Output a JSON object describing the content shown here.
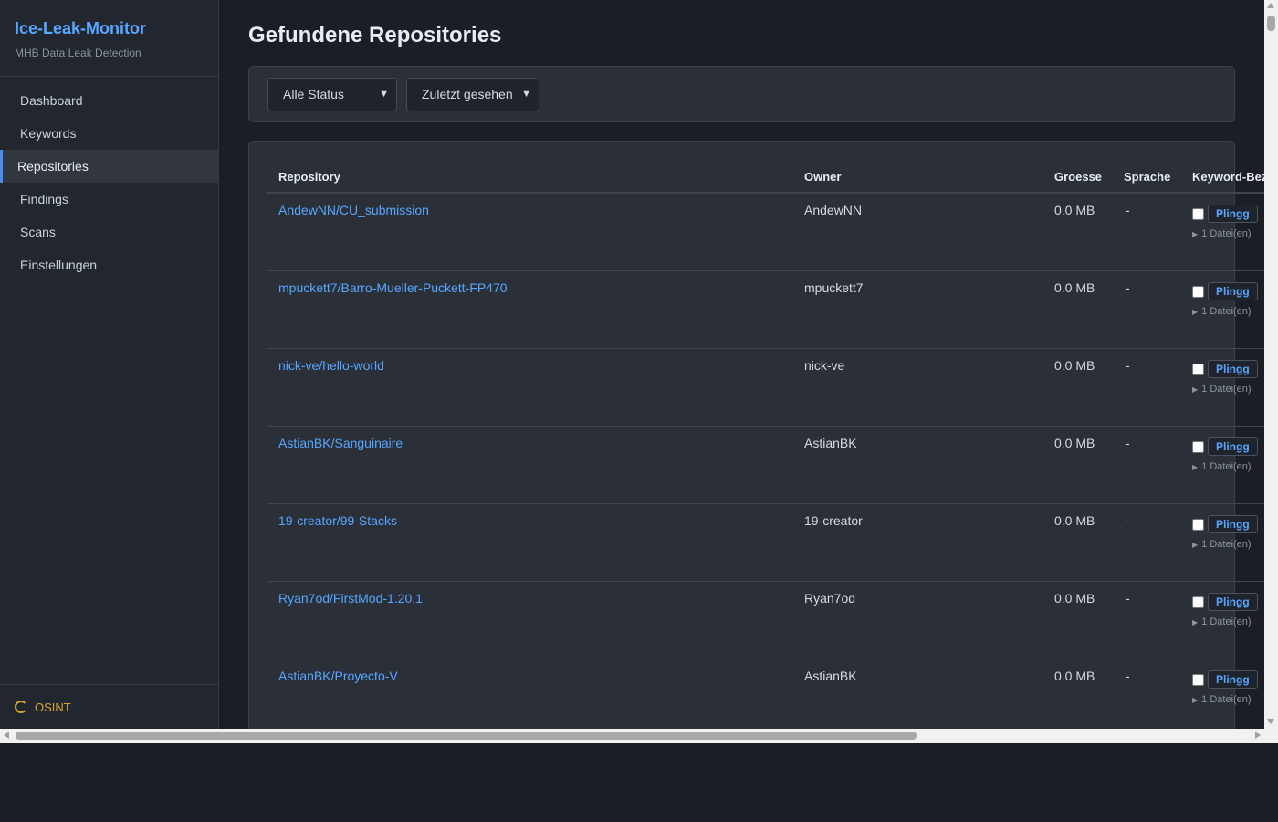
{
  "app": {
    "title": "Ice-Leak-Monitor",
    "subtitle": "MHB Data Leak Detection"
  },
  "sidebar": {
    "items": [
      {
        "label": "Dashboard",
        "active": false
      },
      {
        "label": "Keywords",
        "active": false
      },
      {
        "label": "Repositories",
        "active": true
      },
      {
        "label": "Findings",
        "active": false
      },
      {
        "label": "Scans",
        "active": false
      },
      {
        "label": "Einstellungen",
        "active": false
      }
    ],
    "footer": {
      "label": "OSINT",
      "icon": "spinner-icon",
      "color": "#d4a72c"
    }
  },
  "page": {
    "title": "Gefundene Repositories"
  },
  "filters": {
    "status": {
      "selected": "Alle Status"
    },
    "sort": {
      "selected": "Zuletzt gesehen"
    }
  },
  "table": {
    "columns": {
      "repository": "Repository",
      "owner": "Owner",
      "size": "Groesse",
      "language": "Sprache",
      "keyword": "Keyword-Bez"
    },
    "rows": [
      {
        "repo": "AndewNN/CU_submission",
        "owner": "AndewNN",
        "size": "0.0 MB",
        "lang": "-",
        "keyword": "Plingg",
        "files": "1 Datei(en)"
      },
      {
        "repo": "mpuckett7/Barro-Mueller-Puckett-FP470",
        "owner": "mpuckett7",
        "size": "0.0 MB",
        "lang": "-",
        "keyword": "Plingg",
        "files": "1 Datei(en)"
      },
      {
        "repo": "nick-ve/hello-world",
        "owner": "nick-ve",
        "size": "0.0 MB",
        "lang": "-",
        "keyword": "Plingg",
        "files": "1 Datei(en)"
      },
      {
        "repo": "AstianBK/Sanguinaire",
        "owner": "AstianBK",
        "size": "0.0 MB",
        "lang": "-",
        "keyword": "Plingg",
        "files": "1 Datei(en)"
      },
      {
        "repo": "19-creator/99-Stacks",
        "owner": "19-creator",
        "size": "0.0 MB",
        "lang": "-",
        "keyword": "Plingg",
        "files": "1 Datei(en)"
      },
      {
        "repo": "Ryan7od/FirstMod-1.20.1",
        "owner": "Ryan7od",
        "size": "0.0 MB",
        "lang": "-",
        "keyword": "Plingg",
        "files": "1 Datei(en)"
      },
      {
        "repo": "AstianBK/Proyecto-V",
        "owner": "AstianBK",
        "size": "0.0 MB",
        "lang": "-",
        "keyword": "Plingg",
        "files": "1 Datei(en)"
      }
    ]
  },
  "colors": {
    "accent": "#58a6ff",
    "background": "#1b1e25",
    "sidebar": "#22262e",
    "card": "#2a2f38",
    "warning": "#d4a72c"
  }
}
